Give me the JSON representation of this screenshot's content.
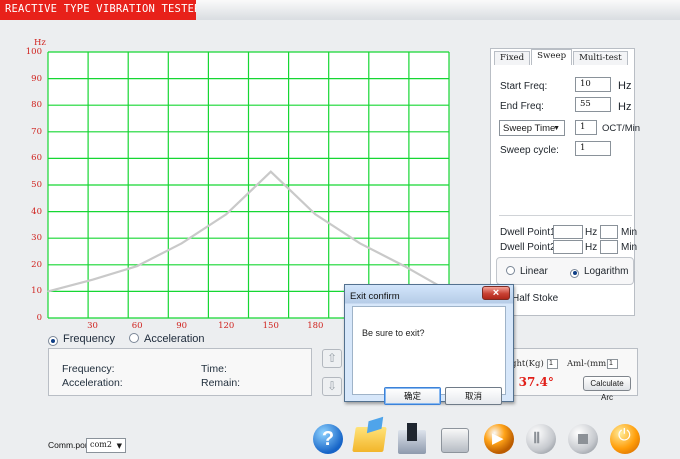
{
  "title": "REACTIVE TYPE VIBRATION TESTER",
  "colors": {
    "title_bar": "#e8211a",
    "grid": "#16d733",
    "sweep_curve": "#c9c9c9",
    "axis_text": "#d0221e"
  },
  "chart_data": {
    "type": "line",
    "title": "",
    "xlabel": "",
    "ylabel": "Hz",
    "x_tick_labels": [
      "30",
      "60",
      "90",
      "120",
      "150",
      "180",
      "210"
    ],
    "y_tick_labels": [
      "0",
      "10",
      "20",
      "30",
      "40",
      "50",
      "60",
      "70",
      "80",
      "90",
      "100"
    ],
    "xlim": [
      0,
      270
    ],
    "ylim": [
      0,
      100
    ],
    "grid": true,
    "series": [
      {
        "x": [
          0,
          30,
          60,
          90,
          120,
          150,
          180,
          210,
          240,
          270
        ],
        "values": [
          10,
          14.4,
          19.5,
          28.1,
          39.0,
          55.0,
          39.0,
          28.1,
          19.5,
          10
        ]
      }
    ]
  },
  "mode_selector": {
    "frequency_label": "Frequency",
    "acceleration_label": "Acceleration",
    "selected": "Frequency"
  },
  "status": {
    "frequency_label": "Frequency:",
    "acceleration_label": "Acceleration:",
    "time_label": "Time:",
    "remain_label": "Remain:"
  },
  "tabs": [
    {
      "label": "Fixed",
      "active": false
    },
    {
      "label": "Sweep",
      "active": true
    },
    {
      "label": "Multi-test",
      "active": false
    }
  ],
  "sweep": {
    "start_freq_label": "Start Freq:",
    "start_freq_value": "10",
    "start_freq_unit": "Hz",
    "end_freq_label": "End Freq:",
    "end_freq_value": "55",
    "end_freq_unit": "Hz",
    "sweep_time_label": "Sweep Time",
    "sweep_time_value": "1",
    "sweep_time_unit": "OCT/Min",
    "sweep_cycle_label": "Sweep cycle:",
    "sweep_cycle_value": "1",
    "dwell_point_1_label": "Dwell Point1:",
    "dwell_point_2_label": "Dwell Point2:",
    "dwell_hz_unit": "Hz",
    "dwell_min_unit": "Min",
    "linear_label": "Linear",
    "logarithm_label": "Logarithm",
    "sweep_scale_selected": "Logarithm",
    "half_stoke_label": "Half Stoke"
  },
  "lower_right": {
    "weight_label": "ght(Kg)",
    "weight_value": "1",
    "aml_label": "Aml-(mm)",
    "aml_value": "1",
    "angle_prefix": ":",
    "angle_value": "37.4°",
    "calculate_arc_label": "Calculate Arc"
  },
  "comm_port": {
    "label": "Comm.port",
    "value": "com2"
  },
  "toolbar_icons": [
    "help-icon",
    "open-folder-icon",
    "save-icon",
    "print-icon",
    "start-icon",
    "pause-icon",
    "stop-icon",
    "power-icon"
  ],
  "dialog": {
    "title": "Exit confirm",
    "message": "Be sure to exit?",
    "confirm_label": "确定",
    "cancel_label": "取消"
  }
}
